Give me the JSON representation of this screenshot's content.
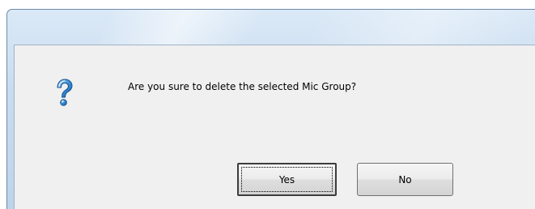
{
  "dialog": {
    "message": "Are you sure to delete the selected Mic Group?",
    "icon": "question-icon",
    "buttons": {
      "yes_label": "Yes",
      "no_label": "No"
    }
  }
}
